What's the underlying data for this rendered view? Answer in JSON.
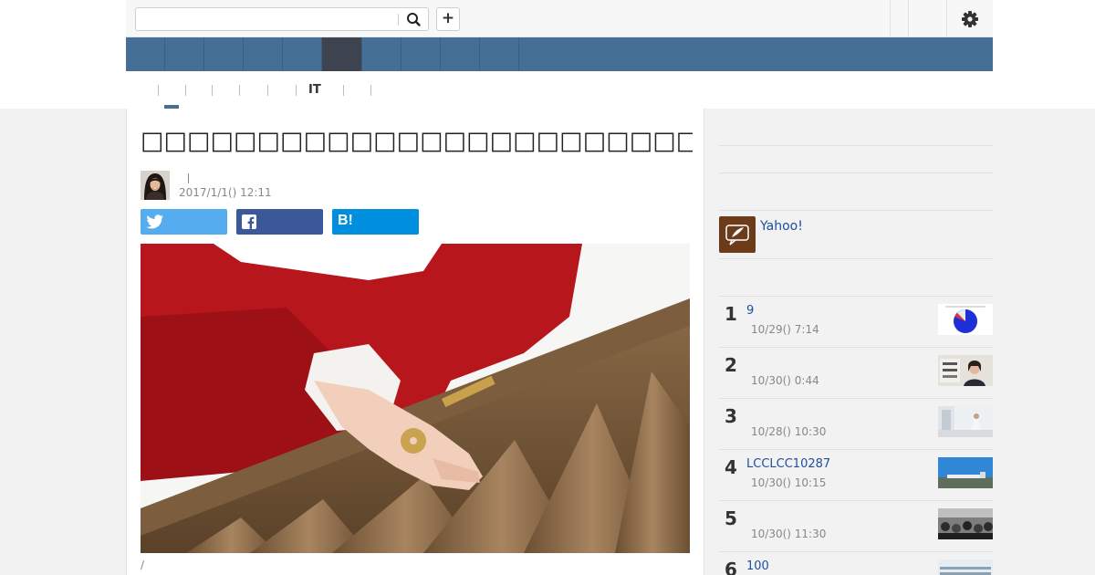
{
  "header": {
    "search_placeholder": "",
    "search_icon": "search-icon",
    "add_label": "+",
    "settings_icon": "gear-icon"
  },
  "nav": {
    "tabs": [
      {
        "label": ""
      },
      {
        "label": ""
      },
      {
        "label": ""
      },
      {
        "label": ""
      },
      {
        "label": ""
      },
      {
        "label": "",
        "active": true
      },
      {
        "label": ""
      },
      {
        "label": ""
      },
      {
        "label": ""
      },
      {
        "label": ""
      }
    ],
    "accent_color": "#466f95",
    "active_color": "#3d4450"
  },
  "subnav": {
    "items": [
      {
        "label": ""
      },
      {
        "label": ""
      },
      {
        "label": ""
      },
      {
        "label": ""
      },
      {
        "label": ""
      },
      {
        "label": "IT"
      },
      {
        "label": ""
      }
    ]
  },
  "article": {
    "title": "□□□□□□□□□□□□□□□□□□□□□□□□□□□□□□□□□",
    "author": "",
    "timestamp": "2017/1/1() 12:11",
    "share": {
      "twitter_icon": "twitter-icon",
      "facebook_icon": "facebook-icon",
      "hatena_label": "B!"
    },
    "image_caption": "/"
  },
  "sidebar": {
    "yahoo_label": "Yahoo!",
    "ranking": [
      {
        "rank": "1",
        "title": "9",
        "time": "10/29() 7:14"
      },
      {
        "rank": "2",
        "title": "",
        "time": "10/30() 0:44"
      },
      {
        "rank": "3",
        "title": "",
        "time": "10/28() 10:30"
      },
      {
        "rank": "4",
        "title": "LCCLCC10287",
        "time": "10/30() 10:15"
      },
      {
        "rank": "5",
        "title": "",
        "time": "10/30() 11:30"
      },
      {
        "rank": "6",
        "title": "100",
        "time": ""
      }
    ]
  }
}
